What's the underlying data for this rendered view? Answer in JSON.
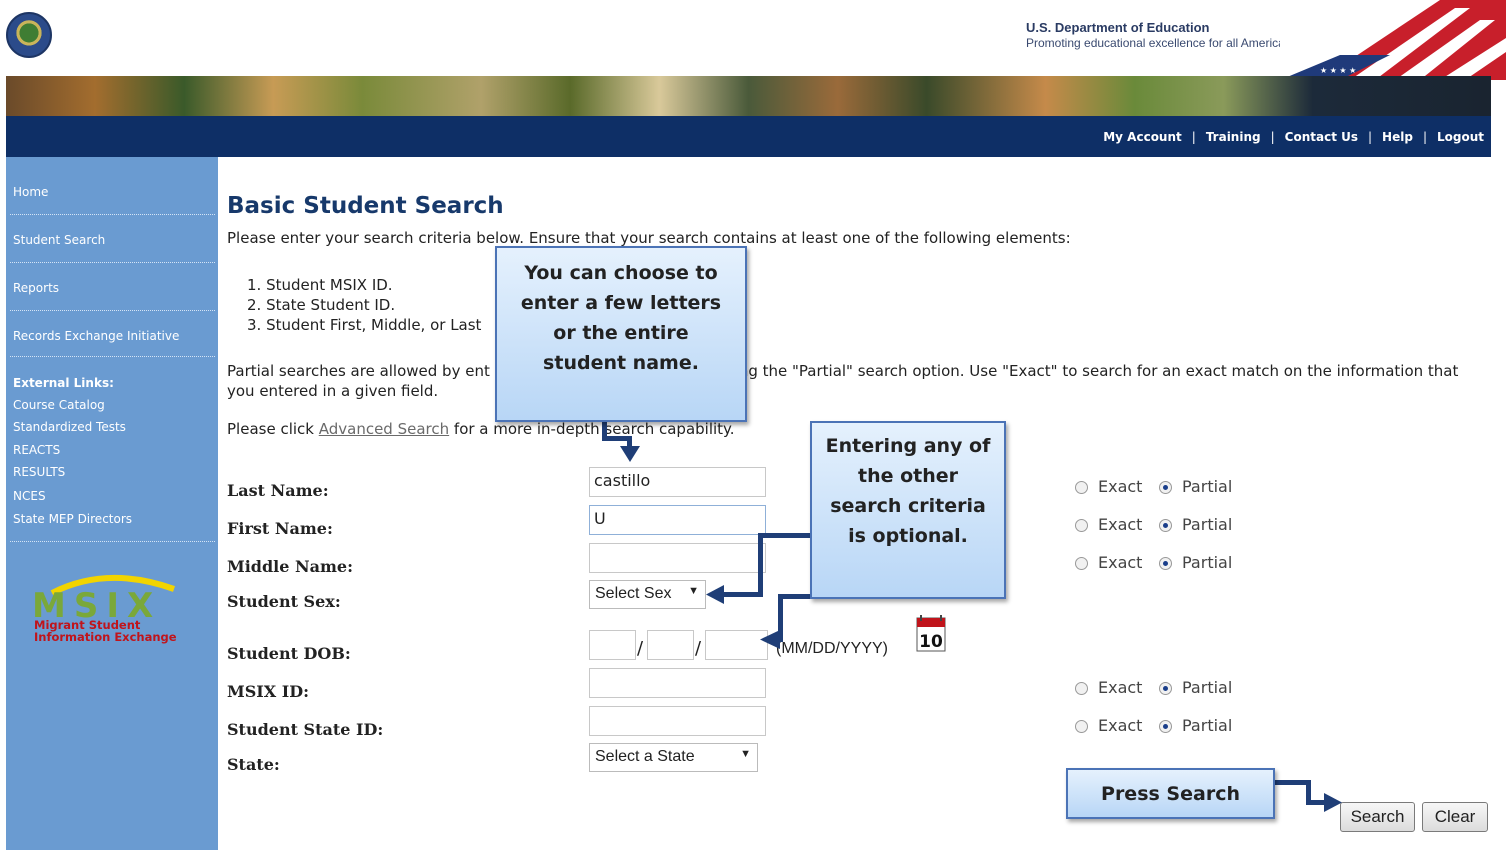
{
  "header": {
    "dept_name": "U.S. Department of Education",
    "dept_tagline": "Promoting educational excellence for all Americans",
    "top_links": [
      "My Account",
      "Training",
      "Contact Us",
      "Help",
      "Logout"
    ]
  },
  "sidebar": {
    "items": [
      "Home",
      "Student Search",
      "Reports",
      "Records Exchange Initiative"
    ],
    "external_heading": "External Links:",
    "external_links": [
      "Course Catalog",
      "Standardized Tests",
      "REACTS",
      "RESULTS",
      "NCES",
      "State MEP Directors"
    ],
    "logo_text": "MSIX",
    "logo_sub1": "Migrant Student",
    "logo_sub2": "Information Exchange"
  },
  "main": {
    "title": "Basic Student Search",
    "instructions": "Please enter your search criteria below. Ensure that your search contains at least one of the following elements:",
    "list": [
      "1.  Student MSIX ID.",
      "2.  State Student ID.",
      "3.  Student First, Middle, or Last"
    ],
    "partial_text": "Partial searches are allowed by ent                                          selecting the \"Partial\" search option. Use \"Exact\" to search for an exact match on the information that you entered in a given field.",
    "adv_prefix": "Please click ",
    "adv_link": "Advanced Search",
    "adv_suffix": " for a more in-depth search capability."
  },
  "form": {
    "last_name_label": "Last Name:",
    "last_name_value": "castillo",
    "first_name_label": "First Name:",
    "first_name_value": "U",
    "middle_name_label": "Middle Name:",
    "middle_name_value": "",
    "sex_label": "Student Sex:",
    "sex_value": "Select Sex",
    "dob_label": "Student DOB:",
    "dob_format": "(MM/DD/YYYY)",
    "calendar_day": "10",
    "msix_label": "MSIX ID:",
    "state_id_label": "Student State ID:",
    "state_label": "State:",
    "state_value": "Select a State",
    "exact_label": "Exact",
    "partial_label": "Partial",
    "search_button": "Search",
    "clear_button": "Clear"
  },
  "callouts": {
    "choose": "You can choose to enter a few letters or the entire student name.",
    "optional": "Entering any of the other search criteria is optional.",
    "press": "Press Search"
  }
}
